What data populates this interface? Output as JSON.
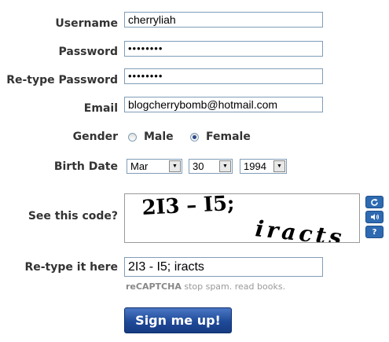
{
  "form": {
    "username": {
      "label": "Username",
      "value": "cherryliah"
    },
    "password": {
      "label": "Password",
      "value": "••••••••"
    },
    "retype_password": {
      "label": "Re-type Password",
      "value": "••••••••"
    },
    "email": {
      "label": "Email",
      "value": "blogcherrybomb@hotmail.com"
    },
    "gender": {
      "label": "Gender",
      "options": [
        "Male",
        "Female"
      ],
      "selected": "Female"
    },
    "birth_date": {
      "label": "Birth Date",
      "month": "Mar",
      "day": "30",
      "year": "1994"
    },
    "captcha": {
      "label": "See this code?",
      "word1": "2I3 – I5;",
      "word2": "iracts",
      "icons": [
        "refresh-icon",
        "audio-icon",
        "help-icon"
      ]
    },
    "captcha_response": {
      "label": "Re-type it here",
      "value": "2I3 - I5; iracts"
    },
    "recaptcha_tagline": {
      "brand": "reCAPTCHA",
      "text": " stop spam. read books."
    },
    "submit_label": "Sign me up!"
  },
  "colors": {
    "accent": "#1f4a99",
    "control_blue": "#2e6ab1",
    "border": "#7f9db9"
  }
}
